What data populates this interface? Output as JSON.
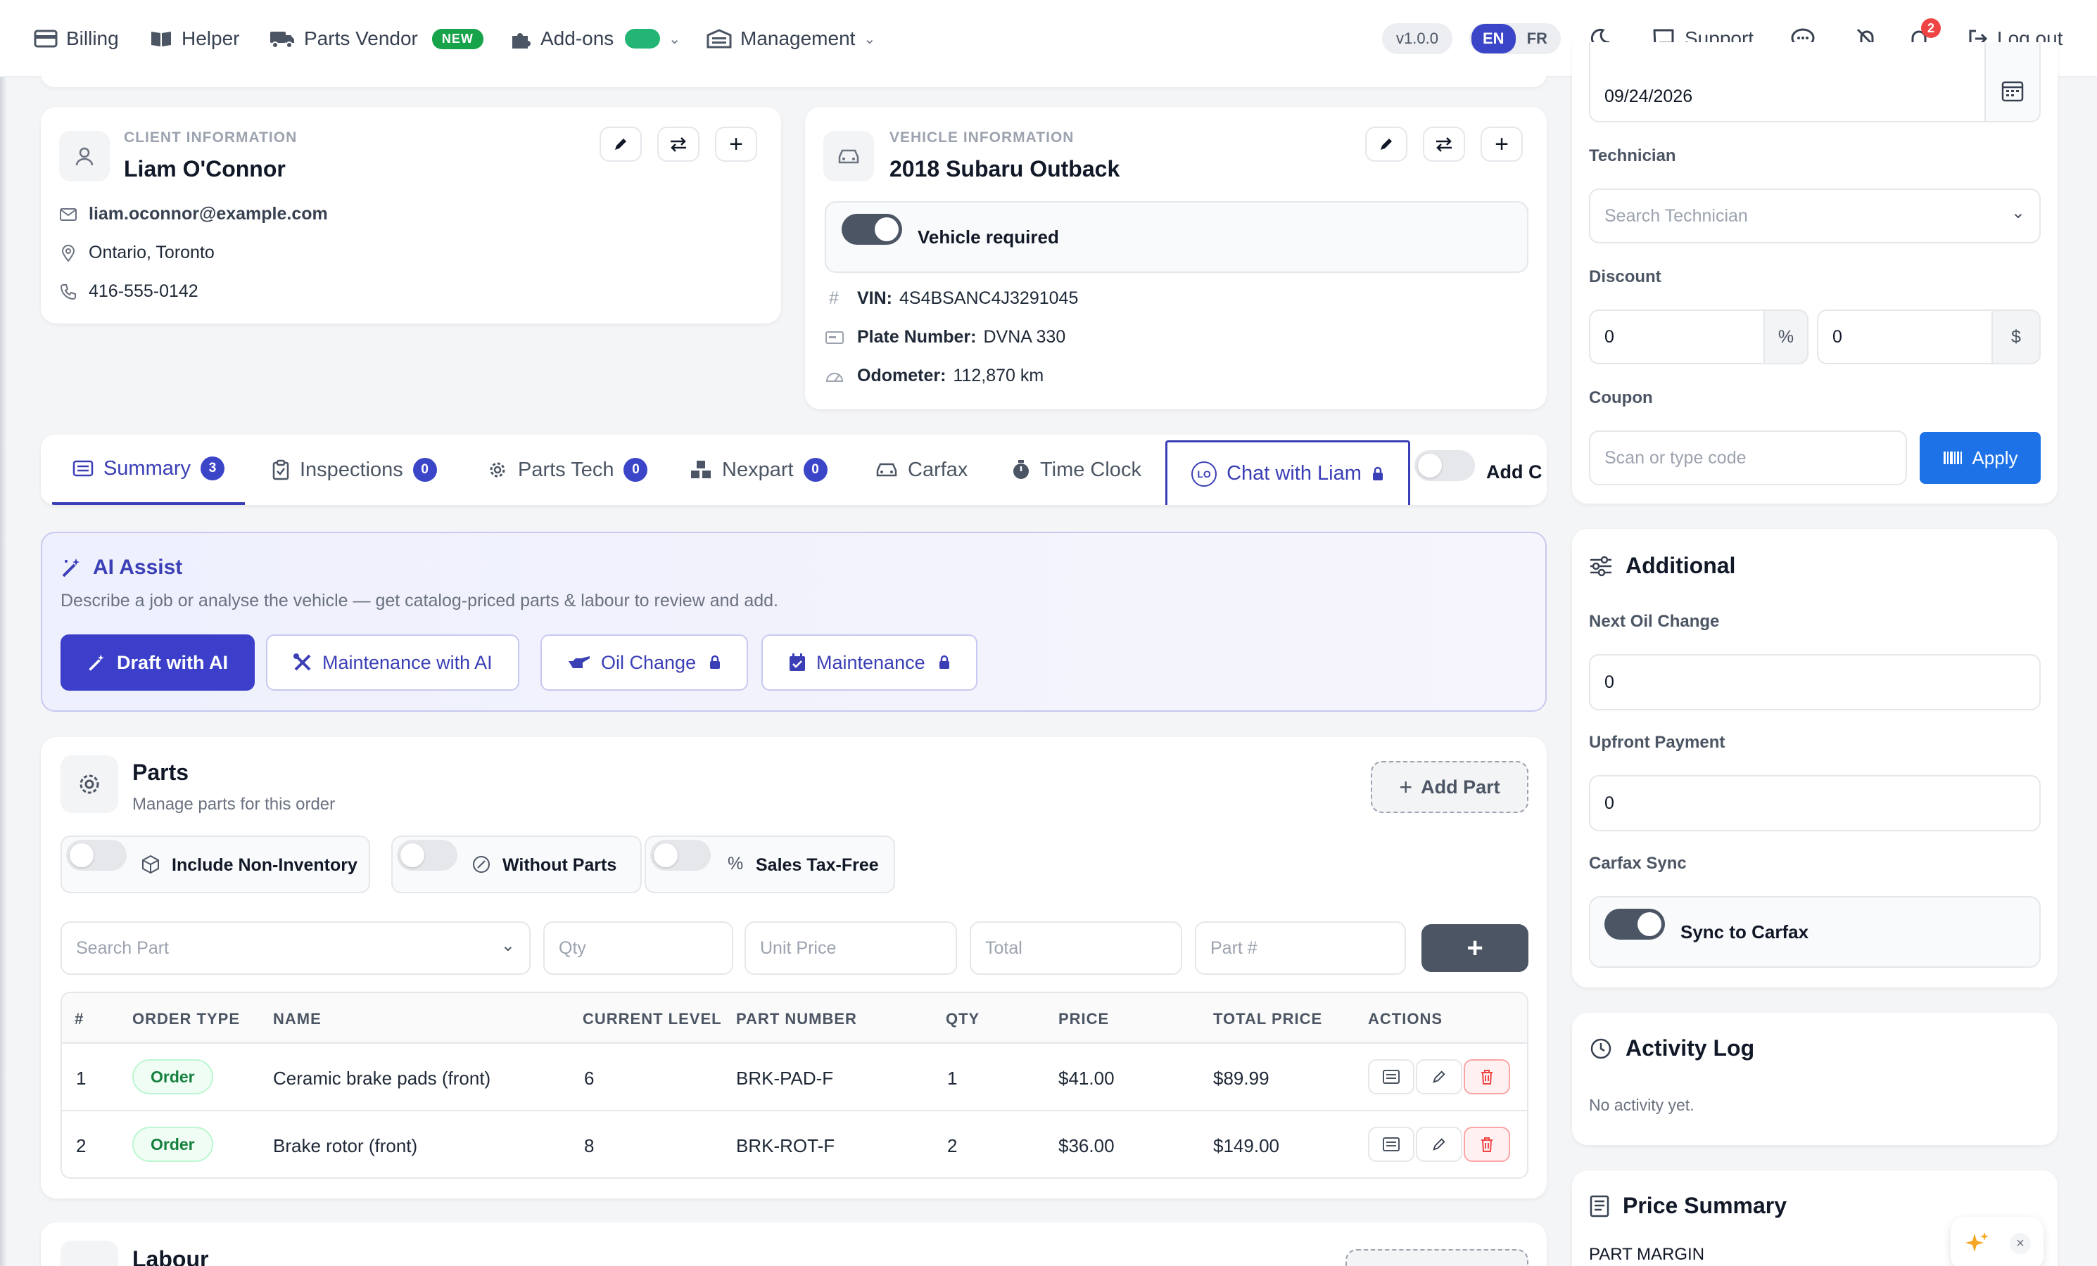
{
  "nav": {
    "billing": "Billing",
    "helper": "Helper",
    "parts_vendor": "Parts Vendor",
    "new_badge": "NEW",
    "addons": "Add-ons",
    "management": "Management",
    "version": "v1.0.0",
    "lang_en": "EN",
    "lang_fr": "FR",
    "support": "Support",
    "notification_count": "2",
    "logout": "Log out"
  },
  "client": {
    "section_label": "CLIENT INFORMATION",
    "name": "Liam O'Connor",
    "email": "liam.oconnor@example.com",
    "location": "Ontario, Toronto",
    "phone": "416-555-0142"
  },
  "vehicle": {
    "section_label": "VEHICLE INFORMATION",
    "name": "2018 Subaru Outback",
    "required_label": "Vehicle required",
    "vin_label": "VIN:",
    "vin": "4S4BSANC4J3291045",
    "plate_label": "Plate Number:",
    "plate": "DVNA 330",
    "odometer_label": "Odometer:",
    "odometer": "112,870 km"
  },
  "tabs": [
    {
      "label": "Summary",
      "count": "3"
    },
    {
      "label": "Inspections",
      "count": "0"
    },
    {
      "label": "Parts Tech",
      "count": "0"
    },
    {
      "label": "Nexpart",
      "count": "0"
    },
    {
      "label": "Carfax"
    },
    {
      "label": "Time Clock"
    },
    {
      "label": "Chat with Liam",
      "avatar": "LO"
    }
  ],
  "tab_add": "Add C",
  "ai": {
    "title": "AI Assist",
    "description": "Describe a job or analyse the vehicle — get catalog-priced parts & labour to review and add.",
    "draft": "Draft with AI",
    "maintenance_ai": "Maintenance with AI",
    "oil_change": "Oil Change",
    "maintenance": "Maintenance"
  },
  "parts": {
    "title": "Parts",
    "subtitle": "Manage parts for this order",
    "add_button": "Add Part",
    "toggle_non_inventory": "Include Non-Inventory",
    "toggle_without_parts": "Without Parts",
    "toggle_tax_free": "Sales Tax-Free",
    "search_placeholder": "Search Part",
    "qty_placeholder": "Qty",
    "unit_price_placeholder": "Unit Price",
    "total_placeholder": "Total",
    "part_no_placeholder": "Part #",
    "columns": [
      "#",
      "ORDER TYPE",
      "NAME",
      "CURRENT LEVEL",
      "PART NUMBER",
      "QTY",
      "PRICE",
      "TOTAL PRICE",
      "ACTIONS"
    ],
    "rows": [
      {
        "num": "1",
        "type": "Order",
        "name": "Ceramic brake pads (front)",
        "level": "6",
        "part_number": "BRK-PAD-F",
        "qty": "1",
        "price": "$41.00",
        "total": "$89.99"
      },
      {
        "num": "2",
        "type": "Order",
        "name": "Brake rotor (front)",
        "level": "8",
        "part_number": "BRK-ROT-F",
        "qty": "2",
        "price": "$36.00",
        "total": "$149.00"
      }
    ]
  },
  "labour": {
    "title": "Labour"
  },
  "side": {
    "date": "09/24/2026",
    "technician_label": "Technician",
    "technician_placeholder": "Search Technician",
    "discount_label": "Discount",
    "discount_pct": "0",
    "pct_symbol": "%",
    "discount_amt": "0",
    "dollar_symbol": "$",
    "coupon_label": "Coupon",
    "coupon_placeholder": "Scan or type code",
    "apply": "Apply"
  },
  "additional": {
    "title": "Additional",
    "next_oil_label": "Next Oil Change",
    "next_oil_value": "0",
    "upfront_label": "Upfront Payment",
    "upfront_value": "0",
    "carfax_label": "Carfax Sync",
    "carfax_toggle": "Sync to Carfax"
  },
  "activity": {
    "title": "Activity Log",
    "empty": "No activity yet."
  },
  "price_summary": {
    "title": "Price Summary",
    "part_margin": "PART MARGIN"
  },
  "colors": {
    "accent": "#3b3fb6",
    "apply_blue": "#1d72e8",
    "toggle_on": "#4b5563",
    "new_badge": "#16a34a"
  }
}
